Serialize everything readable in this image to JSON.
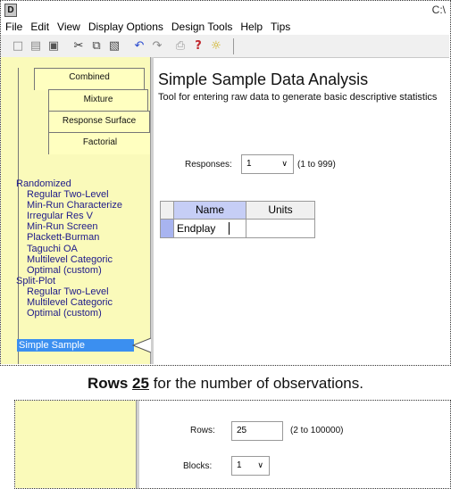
{
  "window": {
    "title_right": "C:\\"
  },
  "menu": [
    "File",
    "Edit",
    "View",
    "Display Options",
    "Design Tools",
    "Help",
    "Tips"
  ],
  "tabs": {
    "combined": "Combined",
    "mixture": "Mixture",
    "response_surface": "Response Surface",
    "factorial": "Factorial"
  },
  "designs": {
    "randomized_header": "Randomized",
    "randomized": [
      "Regular Two-Level",
      "Min-Run Characterize",
      "Irregular Res V",
      "Min-Run Screen",
      "Plackett-Burman",
      "Taguchi OA",
      "Multilevel Categoric",
      "Optimal (custom)"
    ],
    "splitplot_header": "Split-Plot",
    "splitplot": [
      "Regular Two-Level",
      "Multilevel Categoric",
      "Optimal (custom)"
    ],
    "selected": "Simple Sample"
  },
  "main": {
    "title": "Simple Sample Data Analysis",
    "subtitle": "Tool for entering raw data to generate basic descriptive statistics",
    "responses_label": "Responses:",
    "responses_value": "1",
    "responses_range": "(1 to 999)",
    "grid": {
      "col_name": "Name",
      "col_units": "Units",
      "row_name": "Endplay",
      "row_units": ""
    }
  },
  "caption": {
    "prefix": "Rows ",
    "value": "25",
    "suffix": " for the number of observations."
  },
  "second": {
    "rows_label": "Rows:",
    "rows_value": "25",
    "rows_range": "(2 to 100000)",
    "blocks_label": "Blocks:",
    "blocks_value": "1"
  },
  "colors": {
    "panel": "#fafaba",
    "selected": "#3b8ff0",
    "grid_header": "#c6cef6"
  }
}
